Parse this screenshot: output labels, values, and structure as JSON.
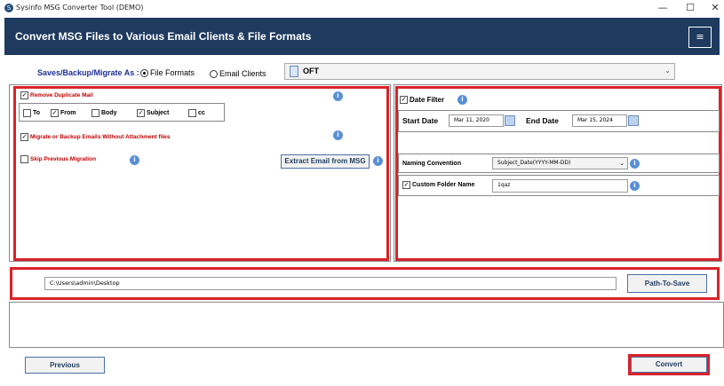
{
  "window": {
    "title": "Sysinfo MSG Converter Tool (DEMO)",
    "minimize": "—",
    "maximize": "☐",
    "close": "✕"
  },
  "header": {
    "title": "Convert MSG Files to Various Email Clients & File Formats",
    "menu_icon": "≡"
  },
  "saves": {
    "label": "Saves/Backup/Migrate As :",
    "option_file_formats": "File Formats",
    "option_email_clients": "Email Clients",
    "selected_option": "File Formats",
    "format_value": "OFT"
  },
  "left_panel": {
    "remove_duplicate": "Remove Duplicate Mail",
    "fields": [
      {
        "label": "To",
        "checked": false
      },
      {
        "label": "From",
        "checked": true
      },
      {
        "label": "Body",
        "checked": false
      },
      {
        "label": "Subject",
        "checked": true
      },
      {
        "label": "cc",
        "checked": false
      }
    ],
    "migrate_without_attachment": "Migrate or Backup Emails Without Attachment files",
    "skip_previous": "Skip Previous Migration",
    "extract_button": "Extract Email from MSG"
  },
  "right_panel": {
    "date_filter": "Date Filter",
    "start_date_label": "Start Date",
    "start_date_value": "Mar 11, 2020",
    "end_date_label": "End Date",
    "end_date_value": "Mar 15, 2024",
    "naming_label": "Naming Convention",
    "naming_value": "Subject_Date(YYYY-MM-DD)",
    "custom_folder_label": "Custom Folder Name",
    "custom_folder_value": "1qaz"
  },
  "path": {
    "value": "C:\\Users\\admin\\Desktop",
    "button": "Path-To-Save"
  },
  "footer": {
    "previous": "Previous",
    "convert": "Convert"
  },
  "colors": {
    "header_bg": "#1e3a5f",
    "highlight_red": "#d9222a",
    "label_blue": "#1a2f9c",
    "info_blue": "#5a8fd6"
  }
}
